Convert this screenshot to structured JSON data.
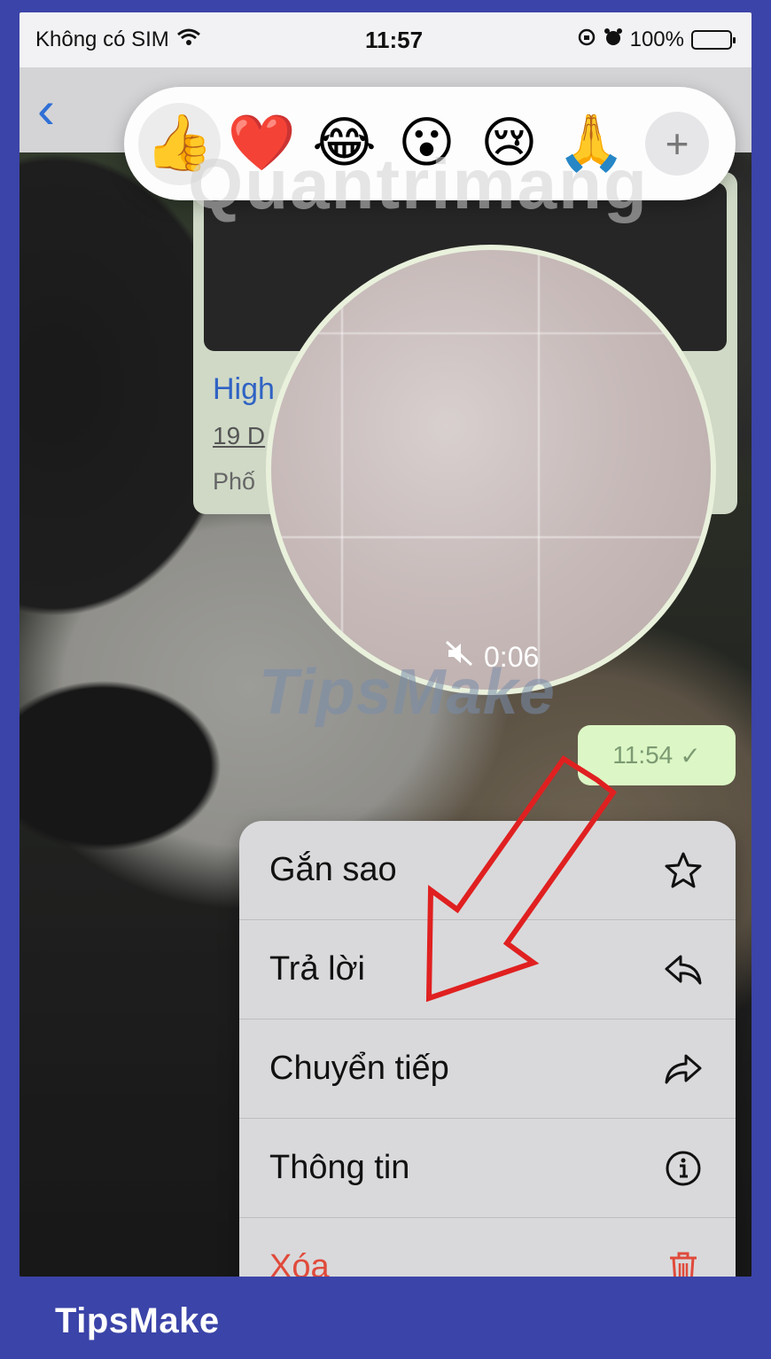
{
  "status_bar": {
    "carrier": "Không có SIM",
    "time": "11:57",
    "battery": "100%",
    "icons": [
      "wifi-icon",
      "rotation-lock-icon",
      "alarm-icon",
      "battery-icon"
    ]
  },
  "reactions": {
    "items": [
      {
        "icon": "thumbs-up",
        "glyph": "👍"
      },
      {
        "icon": "heart",
        "glyph": "❤️"
      },
      {
        "icon": "tears-of-joy",
        "glyph": "😂"
      },
      {
        "icon": "surprised",
        "glyph": "😮"
      },
      {
        "icon": "crying",
        "glyph": "😢"
      },
      {
        "icon": "folded-hands",
        "glyph": "🙏"
      }
    ],
    "more_label": "+"
  },
  "watermarks": {
    "top": "Quantrimang",
    "middle": "TipsMake"
  },
  "message": {
    "title": "High",
    "date": "19 D",
    "place": "Phố"
  },
  "video_note": {
    "duration": "0:06",
    "muted": true
  },
  "sent_time": {
    "time": "11:54",
    "check": "✓"
  },
  "context_menu": {
    "items": [
      {
        "label": "Gắn sao",
        "icon": "star-icon"
      },
      {
        "label": "Trả lời",
        "icon": "reply-icon"
      },
      {
        "label": "Chuyển tiếp",
        "icon": "forward-icon"
      },
      {
        "label": "Thông tin",
        "icon": "info-icon"
      },
      {
        "label": "Xóa",
        "icon": "trash-icon"
      }
    ]
  },
  "colors": {
    "frame": "#3b44a8",
    "accent_blue": "#2f6fd6",
    "danger": "#e04a3b",
    "annotation_arrow": "#e02020"
  },
  "footer": {
    "brand": "TipsMake"
  }
}
